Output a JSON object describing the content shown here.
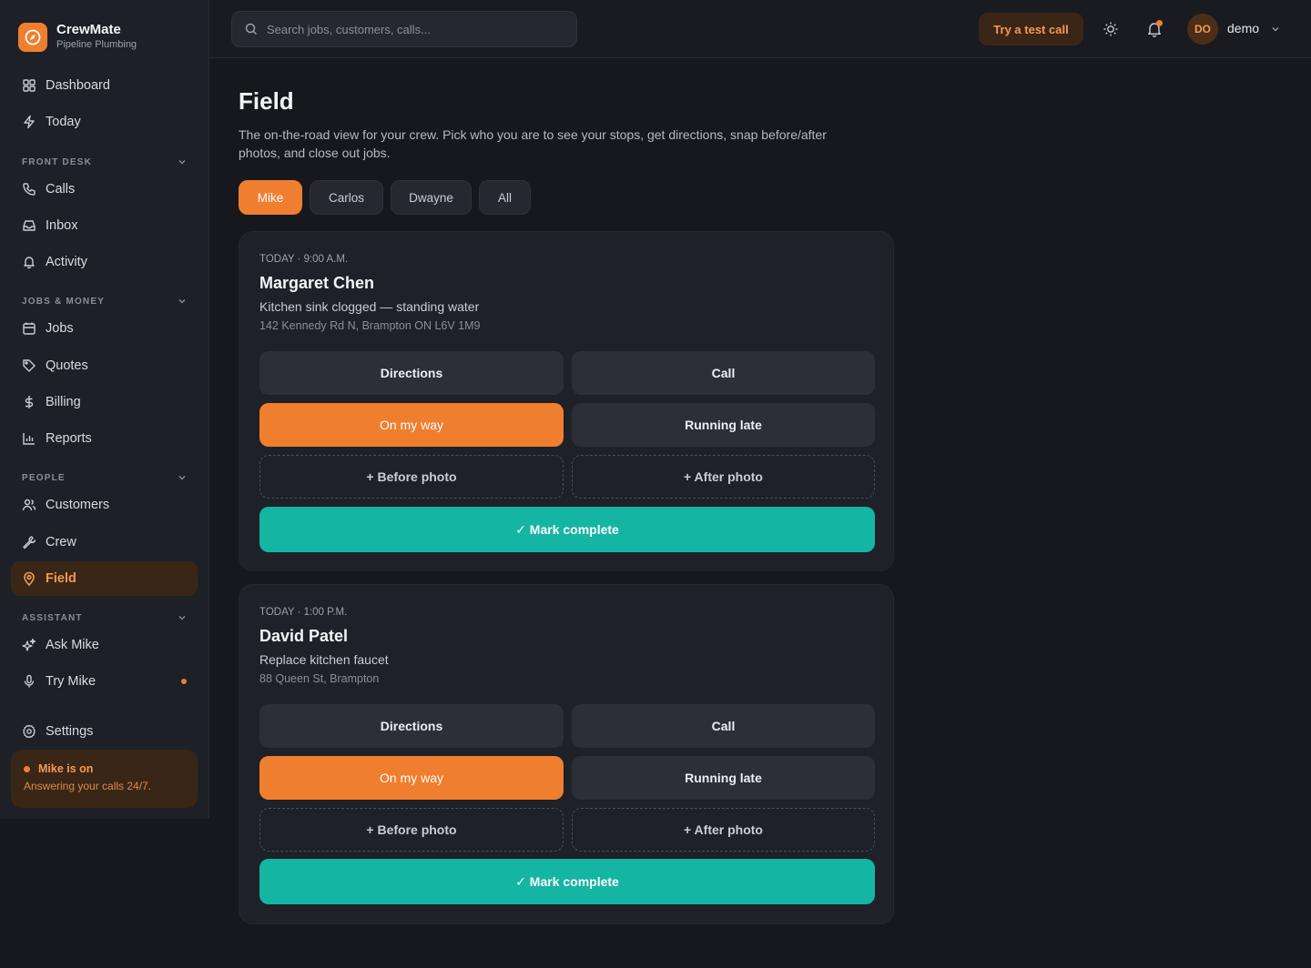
{
  "brand": {
    "name": "CrewMate",
    "subtitle": "Pipeline Plumbing"
  },
  "search": {
    "placeholder": "Search jobs, customers, calls..."
  },
  "topbar": {
    "test_call_label": "Try a test call",
    "avatar_initials": "DO",
    "user_name": "demo"
  },
  "sidebar": {
    "top_items": [
      {
        "label": "Dashboard",
        "icon": "grid-icon"
      },
      {
        "label": "Today",
        "icon": "bolt-icon"
      }
    ],
    "sections": [
      {
        "title": "FRONT DESK",
        "items": [
          {
            "label": "Calls",
            "icon": "phone-icon"
          },
          {
            "label": "Inbox",
            "icon": "inbox-icon"
          },
          {
            "label": "Activity",
            "icon": "bell-icon"
          }
        ]
      },
      {
        "title": "JOBS & MONEY",
        "items": [
          {
            "label": "Jobs",
            "icon": "calendar-icon"
          },
          {
            "label": "Quotes",
            "icon": "tag-icon"
          },
          {
            "label": "Billing",
            "icon": "dollar-icon"
          },
          {
            "label": "Reports",
            "icon": "bar-chart-icon"
          }
        ]
      },
      {
        "title": "PEOPLE",
        "items": [
          {
            "label": "Customers",
            "icon": "users-icon"
          },
          {
            "label": "Crew",
            "icon": "wrench-icon"
          },
          {
            "label": "Field",
            "icon": "map-pin-icon",
            "active": true
          }
        ]
      },
      {
        "title": "ASSISTANT",
        "items": [
          {
            "label": "Ask Mike",
            "icon": "sparkles-icon"
          },
          {
            "label": "Try Mike",
            "icon": "mic-icon"
          }
        ]
      }
    ],
    "settings_label": "Settings",
    "status": {
      "title": "Mike is on",
      "subtitle": "Answering your calls 24/7."
    }
  },
  "page": {
    "title": "Field",
    "description": "The on-the-road view for your crew. Pick who you are to see your stops, get directions, snap before/after photos, and close out jobs."
  },
  "crew_tabs": [
    "Mike",
    "Carlos",
    "Dwayne",
    "All"
  ],
  "actions": {
    "directions": "Directions",
    "call": "Call",
    "on_my_way": "On my way",
    "running_late": "Running late",
    "before_photo": "+ Before photo",
    "after_photo": "+ After photo",
    "mark_complete": "✓ Mark complete"
  },
  "jobs": [
    {
      "time": "TODAY · 9:00 A.M.",
      "customer": "Margaret Chen",
      "description": "Kitchen sink clogged — standing water",
      "address": "142 Kennedy Rd N, Brampton ON L6V 1M9"
    },
    {
      "time": "TODAY · 1:00 P.M.",
      "customer": "David Patel",
      "description": "Replace kitchen faucet",
      "address": "88 Queen St, Brampton"
    }
  ],
  "colors": {
    "accent": "#ef7f2f",
    "complete": "#14b5a3",
    "background": "#17181d",
    "card": "#1f2128"
  }
}
